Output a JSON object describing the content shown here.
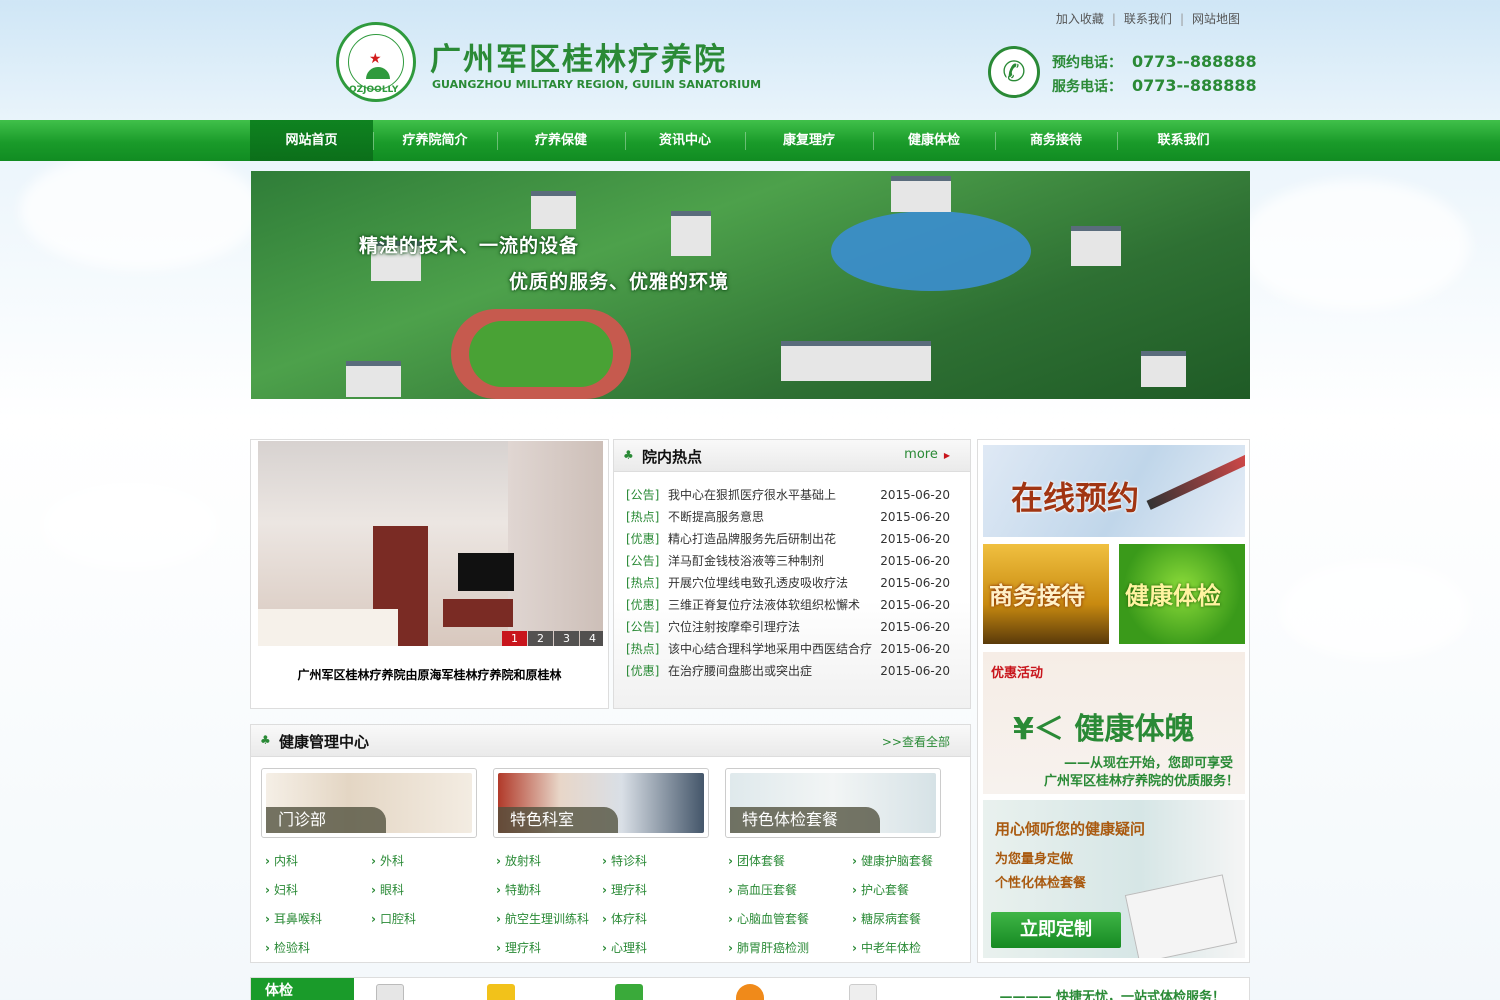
{
  "header": {
    "title": "广州军区桂林疗养院",
    "subtitle": "GUANGZHOU MILITARY REGION, GUILIN SANATORIUM",
    "seal_text": "OZJOOLLY",
    "top_links": [
      "加入收藏",
      "联系我们",
      "网站地图"
    ],
    "phones": [
      {
        "label": "预约电话：",
        "number": "0773--888888"
      },
      {
        "label": "服务电话：",
        "number": "0773--888888"
      }
    ]
  },
  "nav": {
    "items": [
      {
        "label": "网站首页",
        "active": true
      },
      {
        "label": "疗养院简介",
        "active": false
      },
      {
        "label": "疗养保健",
        "active": false
      },
      {
        "label": "资讯中心",
        "active": false
      },
      {
        "label": "康复理疗",
        "active": false
      },
      {
        "label": "健康体检",
        "active": false
      },
      {
        "label": "商务接待",
        "active": false
      },
      {
        "label": "联系我们",
        "active": false
      }
    ]
  },
  "banner": {
    "line1": "精湛的技术、一流的设备",
    "line2": "优质的服务、优雅的环境"
  },
  "slideshow": {
    "dots": [
      "1",
      "2",
      "3",
      "4"
    ],
    "active_dot": "1",
    "caption": "广州军区桂林疗养院由原海军桂林疗养院和原桂林"
  },
  "news": {
    "title": "院内热点",
    "more": "more",
    "items": [
      {
        "tag": "[公告]",
        "title": "我中心在狠抓医疗很水平基础上",
        "date": "2015-06-20"
      },
      {
        "tag": "[热点]",
        "title": "不断提高服务意思",
        "date": "2015-06-20"
      },
      {
        "tag": "[优惠]",
        "title": "精心打造品牌服务先后研制出花",
        "date": "2015-06-20"
      },
      {
        "tag": "[公告]",
        "title": "洋马酊金钱枝浴液等三种制剂",
        "date": "2015-06-20"
      },
      {
        "tag": "[热点]",
        "title": "开展穴位埋线电致孔透皮吸收疗法",
        "date": "2015-06-20"
      },
      {
        "tag": "[优惠]",
        "title": "三维正脊复位疗法液体软组织松懈术",
        "date": "2015-06-20"
      },
      {
        "tag": "[公告]",
        "title": "穴位注射按摩牵引理疗法",
        "date": "2015-06-20"
      },
      {
        "tag": "[热点]",
        "title": "该中心结合理科学地采用中西医结合疗",
        "date": "2015-06-20"
      },
      {
        "tag": "[优惠]",
        "title": "在治疗腰间盘膨出或突出症",
        "date": "2015-06-20"
      }
    ]
  },
  "health_center": {
    "title": "健康管理中心",
    "view_all": ">>查看全部",
    "cards": [
      {
        "caption": "门诊部",
        "links": [
          "内科",
          "外科",
          "妇科",
          "眼科",
          "耳鼻喉科",
          "口腔科",
          "检验科"
        ]
      },
      {
        "caption": "特色科室",
        "links": [
          "放射科",
          "特诊科",
          "特勤科",
          "理疗科",
          "航空生理训练科",
          "体疗科",
          "理疗科",
          "心理科"
        ]
      },
      {
        "caption": "特色体检套餐",
        "links": [
          "团体套餐",
          "健康护脑套餐",
          "高血压套餐",
          "护心套餐",
          "心脑血管套餐",
          "糖尿病套餐",
          "肺胃肝癌检测",
          "中老年体检"
        ]
      }
    ]
  },
  "right": {
    "booking": "在线预约",
    "business": "商务接待",
    "checkup": "健康体检",
    "offer_label": "优惠活动",
    "offer_big": "¥＜ 健康体魄",
    "offer_line1": "——从现在开始，您即可享受",
    "offer_line2": "广州军区桂林疗养院的优质服务！",
    "consult_t1": "用心倾听您的健康疑问",
    "consult_t2": "为您量身定做",
    "consult_t3": "个性化体检套餐",
    "consult_btn": "立即定制"
  },
  "bottom": {
    "tab": "体检",
    "slogan": "———— 快捷无忧，一站式体检服务！"
  },
  "colors": {
    "brand_green": "#2a8a36",
    "nav_green": "#1a9b2a",
    "accent_red": "#c8151c"
  }
}
